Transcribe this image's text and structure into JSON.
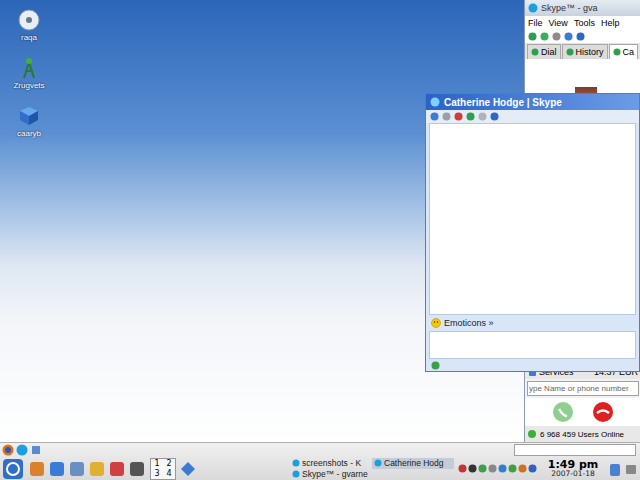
{
  "desktop_icons": [
    {
      "label": "raqa"
    },
    {
      "label": "Zrugvets"
    },
    {
      "label": "caaryb"
    }
  ],
  "skype_main": {
    "title": "Skype™ - gva",
    "menu": [
      "File",
      "View",
      "Tools",
      "Help"
    ],
    "tabs": [
      {
        "label": "Dial",
        "selected": false
      },
      {
        "label": "History",
        "selected": false
      },
      {
        "label": "Ca",
        "selected": true
      }
    ],
    "services": {
      "label": "Services",
      "balance": "14.37 EUR"
    },
    "search": {
      "placeholder": "ype Name or phone number"
    },
    "users_online": "6 968 459 Users Online"
  },
  "chat_window": {
    "title": "Catherine Hodge | Skype",
    "emoticons": "Emoticons »"
  },
  "taskbar": {
    "pager": [
      "1",
      "2",
      "3",
      "4"
    ],
    "tasks": [
      {
        "label": "screenshots - K",
        "selected": false
      },
      {
        "label": "Catherine Hodg",
        "selected": true
      },
      {
        "label": "Skype™ - gvarne",
        "selected": false
      }
    ],
    "clock": {
      "time": "1:49 pm",
      "date": "2007-01-18"
    }
  }
}
